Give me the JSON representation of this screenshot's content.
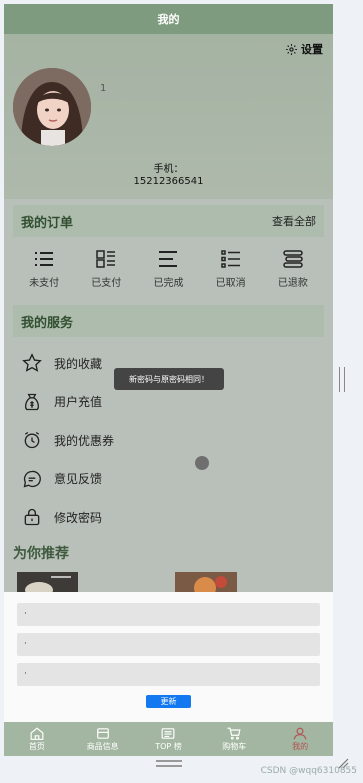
{
  "header": {
    "title": "我的"
  },
  "profile": {
    "settings_label": "设置",
    "user_id": "1",
    "phone_label": "手机：",
    "phone_number": "15212366541"
  },
  "orders": {
    "title": "我的订单",
    "view_all": "查看全部",
    "items": [
      {
        "label": "未支付",
        "icon": "list-icon"
      },
      {
        "label": "已支付",
        "icon": "grid-list-icon"
      },
      {
        "label": "已完成",
        "icon": "lines-icon"
      },
      {
        "label": "已取消",
        "icon": "checklist-icon"
      },
      {
        "label": "已退款",
        "icon": "stack-icon"
      }
    ]
  },
  "services": {
    "title": "我的服务",
    "items": [
      {
        "label": "我的收藏",
        "icon": "star-icon"
      },
      {
        "label": "用户充值",
        "icon": "money-bag-icon"
      },
      {
        "label": "我的优惠券",
        "icon": "coupon-clock-icon"
      },
      {
        "label": "意见反馈",
        "icon": "chat-icon"
      },
      {
        "label": "修改密码",
        "icon": "lock-icon"
      }
    ]
  },
  "recommend": {
    "title": "为你推荐"
  },
  "toast": {
    "message": "新密码与原密码相同！"
  },
  "sheet": {
    "fields": [
      "·",
      "·",
      "·"
    ],
    "update_label": "更新"
  },
  "tabbar": {
    "items": [
      {
        "label": "首页",
        "icon": "home-icon"
      },
      {
        "label": "商品信息",
        "icon": "goods-icon"
      },
      {
        "label": "TOP 榜",
        "icon": "ranking-icon"
      },
      {
        "label": "购物车",
        "icon": "cart-icon"
      },
      {
        "label": "我的",
        "icon": "user-icon"
      }
    ],
    "active_index": 4
  },
  "watermark": "CSDN @wqq6310855",
  "colors": {
    "accent_green": "#7f9b7f",
    "primary_button": "#1478f0",
    "active_tab": "#b25353"
  }
}
